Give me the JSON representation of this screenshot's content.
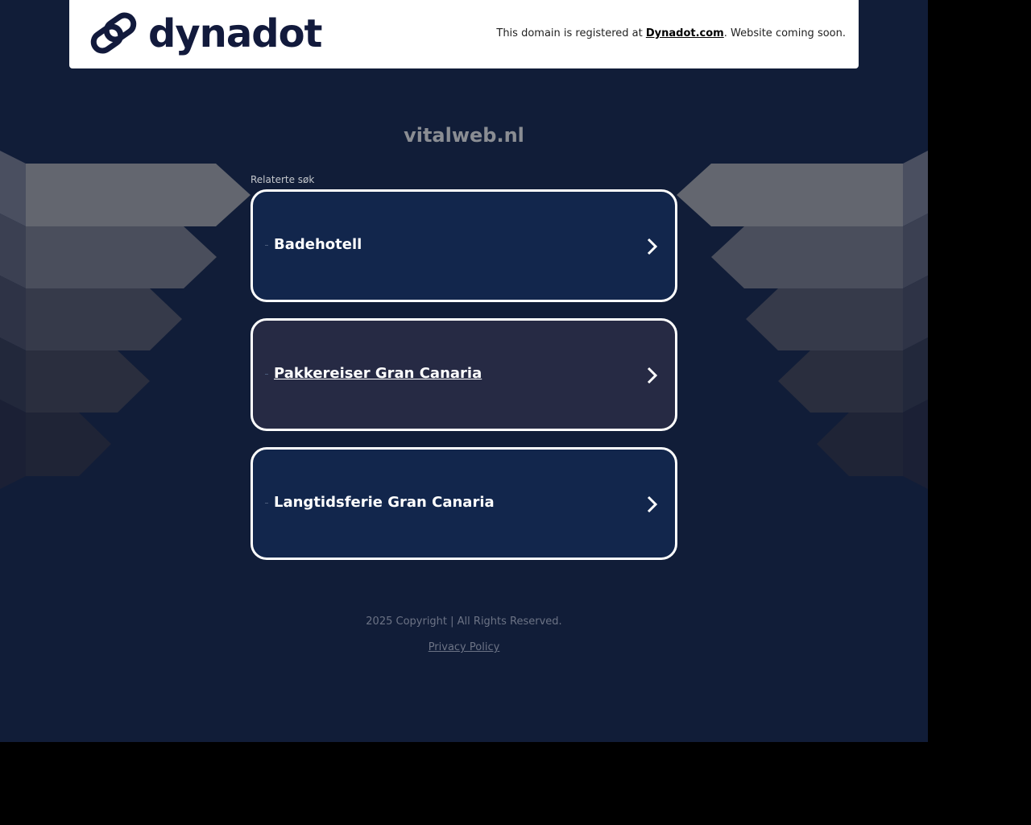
{
  "header": {
    "logo_text": "dynadot",
    "registered_prefix": "This domain is registered at ",
    "registered_link": "Dynadot.com",
    "registered_suffix": ". Website coming soon."
  },
  "main": {
    "domain": "vitalweb.nl",
    "related_label": "Relaterte søk",
    "links": [
      {
        "label": "Badehotell"
      },
      {
        "label": "Pakkereiser Gran Canaria"
      },
      {
        "label": "Langtidsferie Gran Canaria"
      }
    ]
  },
  "footer": {
    "copyright": "2025 Copyright | All Rights Reserved.",
    "privacy": "Privacy Policy"
  },
  "icons": {
    "logo": "dynadot-link-logo-icon",
    "card_arrow": "chevron-right-icon"
  },
  "colors": {
    "background": "#111d38",
    "card": "#12264c",
    "card_hover": "#262a44",
    "brand": "#121a3c"
  }
}
